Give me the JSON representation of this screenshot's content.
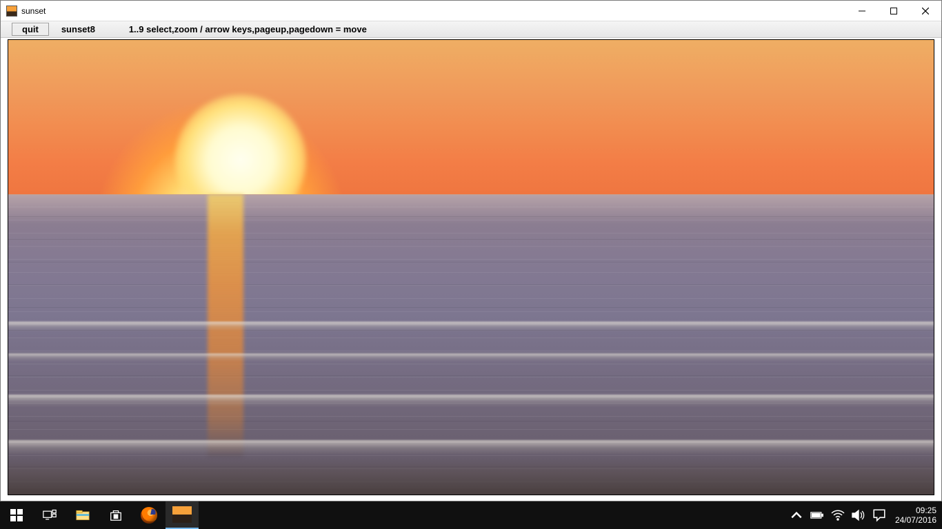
{
  "window": {
    "title": "sunset"
  },
  "toolbar": {
    "quit_label": "quit",
    "image_name": "sunset8",
    "hint": "1..9 select,zoom / arrow keys,pageup,pagedown = move"
  },
  "taskbar": {
    "clock_time": "09:25",
    "clock_date": "24/07/2016"
  }
}
